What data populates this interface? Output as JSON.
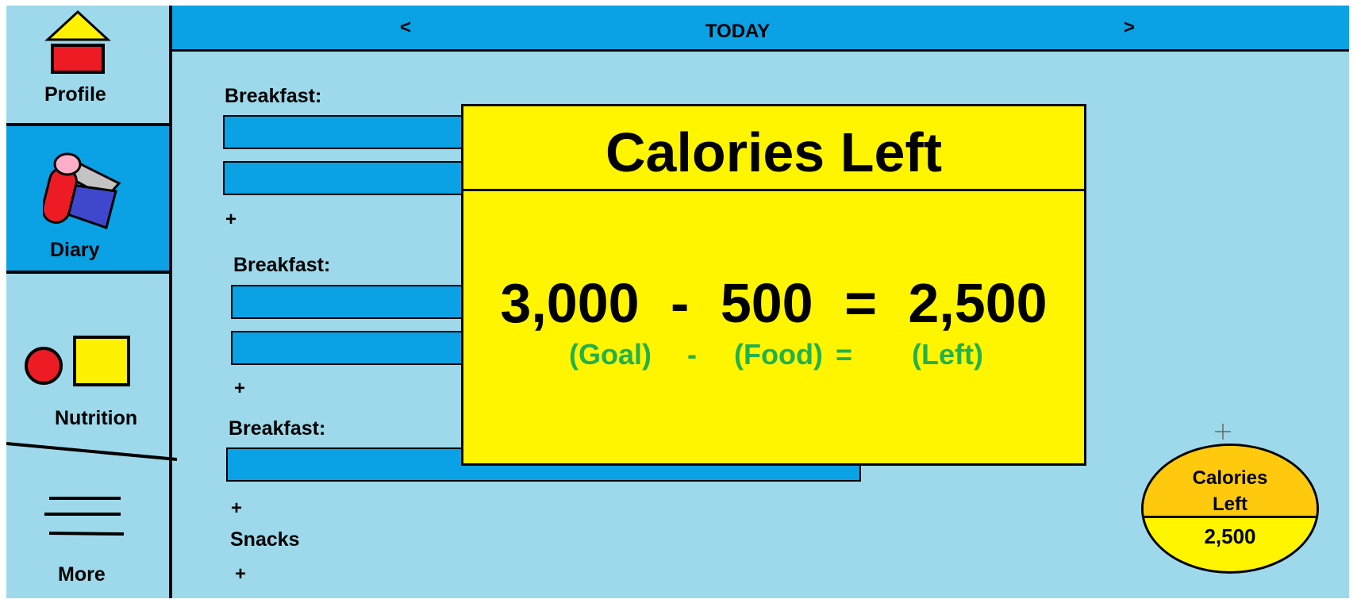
{
  "sidebar": {
    "items": [
      {
        "label": "Profile",
        "icon": "profile-icon"
      },
      {
        "label": "Diary",
        "icon": "diary-icon"
      },
      {
        "label": "Nutrition",
        "icon": "nutrition-icon"
      },
      {
        "label": "More",
        "icon": "menu-icon"
      }
    ],
    "active": "Diary"
  },
  "header": {
    "prev_label": "<",
    "title": "TODAY",
    "next_label": ">"
  },
  "meals": [
    {
      "label": "Breakfast:",
      "add_label": "+"
    },
    {
      "label": "Breakfast:",
      "add_label": "+"
    },
    {
      "label": "Breakfast:",
      "add_label": "+"
    },
    {
      "label": "Snacks",
      "add_label": "+"
    }
  ],
  "popup": {
    "title": "Calories Left",
    "equation": {
      "goal": "3,000",
      "minus": "-",
      "food": "500",
      "equals": "=",
      "left": "2,500"
    },
    "legend": {
      "goal": "(Goal)",
      "minus": "-",
      "food": "(Food)",
      "equals": "=",
      "left": "(Left)"
    }
  },
  "widget": {
    "label": "Calories Left",
    "value": "2,500"
  },
  "colors": {
    "background": "#9dd9ea",
    "accent_blue": "#0aa1e5",
    "popup_yellow": "#fff500",
    "widget_orange": "#ffc90e",
    "legend_green": "#22b14c"
  }
}
